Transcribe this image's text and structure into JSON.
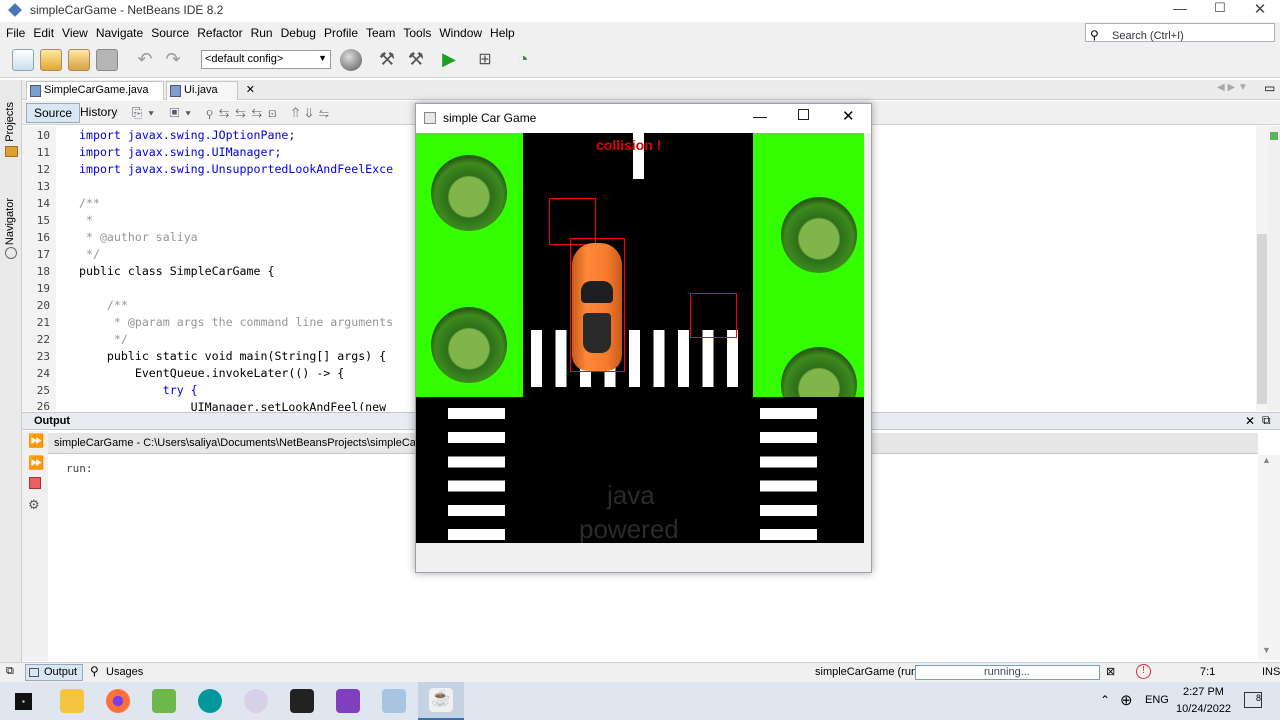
{
  "window": {
    "title": "simpleCarGame - NetBeans IDE 8.2"
  },
  "menu": [
    "File",
    "Edit",
    "View",
    "Navigate",
    "Source",
    "Refactor",
    "Run",
    "Debug",
    "Profile",
    "Team",
    "Tools",
    "Window",
    "Help"
  ],
  "search": {
    "placeholder": "Search (Ctrl+I)"
  },
  "toolbar": {
    "config": "<default config>"
  },
  "tabs": [
    "SimpleCarGame.java",
    "Ui.java"
  ],
  "editor": {
    "source_label": "Source",
    "history_label": "History"
  },
  "side_labels": {
    "projects": "Projects",
    "navigator": "Navigator"
  },
  "code_lines": [
    {
      "n": "10",
      "t": "import javax.swing.JOptionPane;"
    },
    {
      "n": "11",
      "t": "import javax.swing.UIManager;"
    },
    {
      "n": "12",
      "t": "import javax.swing.UnsupportedLookAndFeelExce"
    },
    {
      "n": "13",
      "t": ""
    },
    {
      "n": "14",
      "t": "/**"
    },
    {
      "n": "15",
      "t": " *"
    },
    {
      "n": "16",
      "t": " * @author saliya"
    },
    {
      "n": "17",
      "t": " */"
    },
    {
      "n": "18",
      "t": "public class SimpleCarGame {"
    },
    {
      "n": "19",
      "t": ""
    },
    {
      "n": "20",
      "t": "    /**"
    },
    {
      "n": "21",
      "t": "     * @param args the command line arguments"
    },
    {
      "n": "22",
      "t": "     */"
    },
    {
      "n": "23",
      "t": "    public static void main(String[] args) {"
    },
    {
      "n": "24",
      "t": "        EventQueue.invokeLater(() -> {"
    },
    {
      "n": "25",
      "t": "            try {"
    },
    {
      "n": "26",
      "t": "                UIManager.setLookAndFeel(new"
    }
  ],
  "output": {
    "title": "Output",
    "run_path": "simpleCarGame - C:\\Users\\saliya\\Documents\\NetBeansProjects\\simpleCarGame",
    "content": "run:"
  },
  "status": {
    "tab_output": "Output",
    "tab_usages": "Usages",
    "run_label": "simpleCarGame (run)",
    "progress": "running...",
    "position": "7:1",
    "mode": "INS"
  },
  "game": {
    "title": "simple Car Game",
    "message": "collision !",
    "watermark_line1": "java",
    "watermark_line2": "powered"
  },
  "taskbar": {
    "lang": "ENG",
    "time": "2:27 PM",
    "date": "10/24/2022",
    "notif": "8"
  },
  "colors": {
    "grass": "#33ff00",
    "road": "#000000",
    "car": "#f47a2f",
    "collision": "#ff0000",
    "tree": "#3d8a1f"
  }
}
